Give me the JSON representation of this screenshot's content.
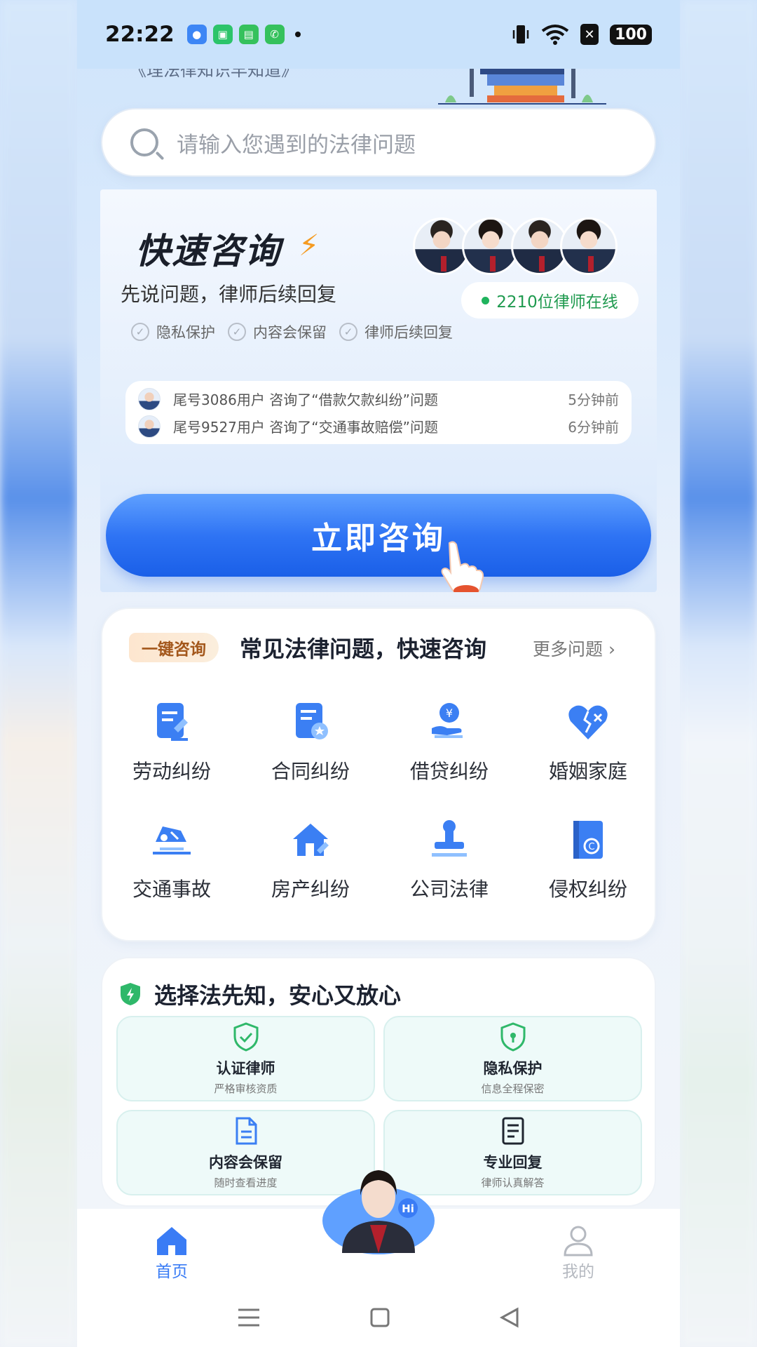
{
  "status_bar": {
    "time": "22:22",
    "battery": "100",
    "icons": [
      "vibrate-icon",
      "wifi-icon",
      "no-sim-icon"
    ]
  },
  "banner": {
    "partial_text": "《理法律知识早知道》"
  },
  "search": {
    "placeholder": "请输入您遇到的法律问题"
  },
  "quick_consult": {
    "title": "快速咨询",
    "subtitle": "先说问题，律师后续回复",
    "features": [
      "隐私保护",
      "内容会保留",
      "律师后续回复"
    ],
    "online_text": "2210位律师在线",
    "ticker": [
      {
        "text": "尾号3086用户 咨询了“借款欠款纠纷”问题",
        "time": "5分钟前"
      },
      {
        "text": "尾号9527用户 咨询了“交通事故赔偿”问题",
        "time": "6分钟前"
      }
    ],
    "cta": "立即咨询"
  },
  "categories": {
    "tag": "一键咨询",
    "title": "常见法律问题，快速咨询",
    "more": "更多问题",
    "items": [
      {
        "label": "劳动纠纷",
        "icon": "labor-contract-icon"
      },
      {
        "label": "合同纠纷",
        "icon": "contract-icon"
      },
      {
        "label": "借贷纠纷",
        "icon": "loan-icon"
      },
      {
        "label": "婚姻家庭",
        "icon": "broken-heart-icon"
      },
      {
        "label": "交通事故",
        "icon": "car-accident-icon"
      },
      {
        "label": "房产纠纷",
        "icon": "house-icon"
      },
      {
        "label": "公司法律",
        "icon": "stamp-icon"
      },
      {
        "label": "侵权纠纷",
        "icon": "copyright-book-icon"
      }
    ]
  },
  "trust": {
    "title": "选择法先知，安心又放心",
    "items": [
      {
        "label": "认证律师",
        "desc": "严格审核资质",
        "icon": "shield-check-icon"
      },
      {
        "label": "隐私保护",
        "desc": "信息全程保密",
        "icon": "shield-lock-icon"
      },
      {
        "label": "内容会保留",
        "desc": "随时查看进度",
        "icon": "document-icon"
      },
      {
        "label": "专业回复",
        "desc": "律师认真解答",
        "icon": "notes-icon"
      }
    ]
  },
  "bottom_nav": {
    "home": "首页",
    "mine": "我的",
    "bot_badge": "Hi"
  },
  "colors": {
    "primary": "#2f74f4",
    "accent_orange": "#f59b22",
    "online_green": "#1f9a4f",
    "nav_active": "#3a7cf5",
    "nav_inactive": "#b5b9c0"
  }
}
